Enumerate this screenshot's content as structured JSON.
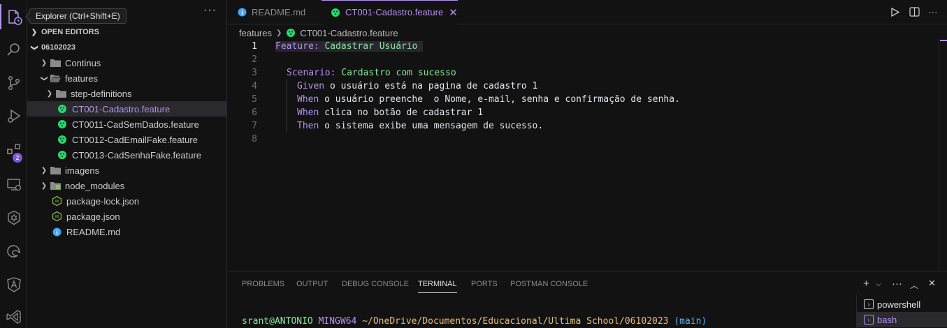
{
  "tooltip": "Explorer (Ctrl+Shift+E)",
  "activity_bar": {
    "items": [
      "files-icon",
      "search-icon",
      "source-control-icon",
      "run-debug-icon",
      "extensions-icon",
      "remote-explorer-icon",
      "kubernetes-icon",
      "edge-icon",
      "angular-icon",
      "visual-studio-icon"
    ],
    "extensions_badge": "2"
  },
  "sidebar": {
    "more": "···",
    "open_editors": "OPEN EDITORS",
    "workspace": "06102023",
    "tree": [
      {
        "label": "Continus",
        "type": "folder",
        "expanded": false
      },
      {
        "label": "features",
        "type": "folder",
        "expanded": true
      },
      {
        "label": "step-definitions",
        "type": "folder",
        "expanded": false
      },
      {
        "label": "CT001-Cadastro.feature",
        "type": "cucumber",
        "selected": true
      },
      {
        "label": "CT0011-CadSemDados.feature",
        "type": "cucumber"
      },
      {
        "label": "CT0012-CadEmailFake.feature",
        "type": "cucumber"
      },
      {
        "label": "CT0013-CadSenhaFake.feature",
        "type": "cucumber"
      },
      {
        "label": "imagens",
        "type": "folder",
        "expanded": false
      },
      {
        "label": "node_modules",
        "type": "node-folder",
        "expanded": false
      },
      {
        "label": "package-lock.json",
        "type": "node-json"
      },
      {
        "label": "package.json",
        "type": "node-json"
      },
      {
        "label": "README.md",
        "type": "info"
      }
    ]
  },
  "tabs": [
    {
      "label": "README.md",
      "active": false
    },
    {
      "label": "CT001-Cadastro.feature",
      "active": true
    }
  ],
  "breadcrumb": {
    "folder": "features",
    "file": "CT001-Cadastro.feature"
  },
  "code": {
    "line_numbers": [
      "1",
      "2",
      "3",
      "4",
      "5",
      "6",
      "7",
      "8"
    ],
    "l1_kw": "Feature:",
    "l1_name": " Cadastrar Usuário ",
    "l3_kw": "Scenario:",
    "l3_name": " Cardastro com sucesso",
    "l4_kw": "Given",
    "l4_text": " o usuário está na pagina de cadastro 1",
    "l5_kw": "When",
    "l5_text": " o usuário preenche  o Nome, e-mail, senha e confirmação de senha.",
    "l6_kw": "When",
    "l6_text": " clica no botão de cadastrar 1",
    "l7_kw": "Then",
    "l7_text": " o sistema exibe uma mensagem de sucesso."
  },
  "panel": {
    "tabs": [
      "PROBLEMS",
      "OUTPUT",
      "DEBUG CONSOLE",
      "TERMINAL",
      "PORTS",
      "POSTMAN CONSOLE"
    ],
    "active_tab": "TERMINAL",
    "terminal": {
      "user": "srant@ANTONIO",
      "host": "MINGW64",
      "path": "~/OneDrive/Documentos/Educacional/Ultima School/06102023",
      "branch": "(main)"
    },
    "terminals": [
      "powershell",
      "bash"
    ],
    "selected_terminal": "bash"
  },
  "colors": {
    "accent": "#b392f0",
    "keyword": "#b392f0",
    "name": "#85e89d",
    "cucumber": "#23d96c",
    "folder": "#8b8b8b"
  }
}
